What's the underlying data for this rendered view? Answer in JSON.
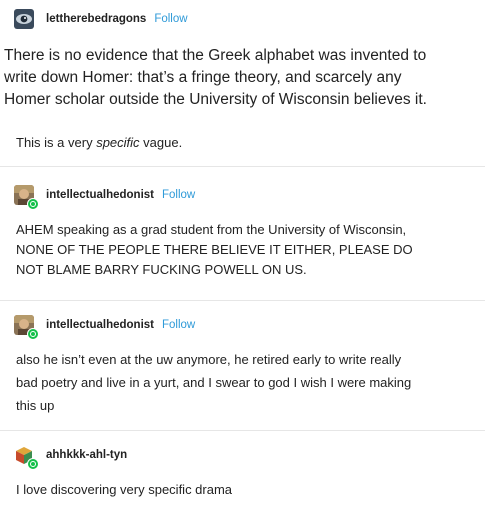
{
  "posts": [
    {
      "username": "lettherebedragons",
      "follow_label": "Follow",
      "avatar_icon": "eye-icon",
      "quote_lines": [
        "There is no evidence that the Greek alphabet was invented to",
        "write down Homer: that’s a fringe theory, and scarcely any",
        "Homer scholar outside the University of Wisconsin believes it."
      ],
      "body_before": "This is a very ",
      "body_italic": "specific",
      "body_after": " vague."
    },
    {
      "username": "intellectualhedonist",
      "follow_label": "Follow",
      "avatar_icon": "person-photo-icon",
      "lines": [
        "AHEM speaking as a grad student from the University of Wisconsin,",
        "NONE OF THE PEOPLE THERE BELIEVE IT EITHER, PLEASE DO",
        "NOT BLAME BARRY FUCKING POWELL ON US."
      ]
    },
    {
      "username": "intellectualhedonist",
      "follow_label": "Follow",
      "avatar_icon": "person-photo-icon",
      "lines": [
        "also he isn’t even at the uw anymore, he retired early to write really",
        "bad poetry and live in a yurt, and I swear to god I wish I were making",
        "this up"
      ]
    },
    {
      "username": "ahhkkk-ahl-tyn",
      "follow_label": "",
      "avatar_icon": "cube-icon",
      "lines": [
        "I love discovering very specific drama"
      ]
    }
  ],
  "colors": {
    "text": "#222222",
    "follow_link": "#2f9ad8",
    "reblog_badge": "#15c04a",
    "divider": "#e6e6e6"
  }
}
